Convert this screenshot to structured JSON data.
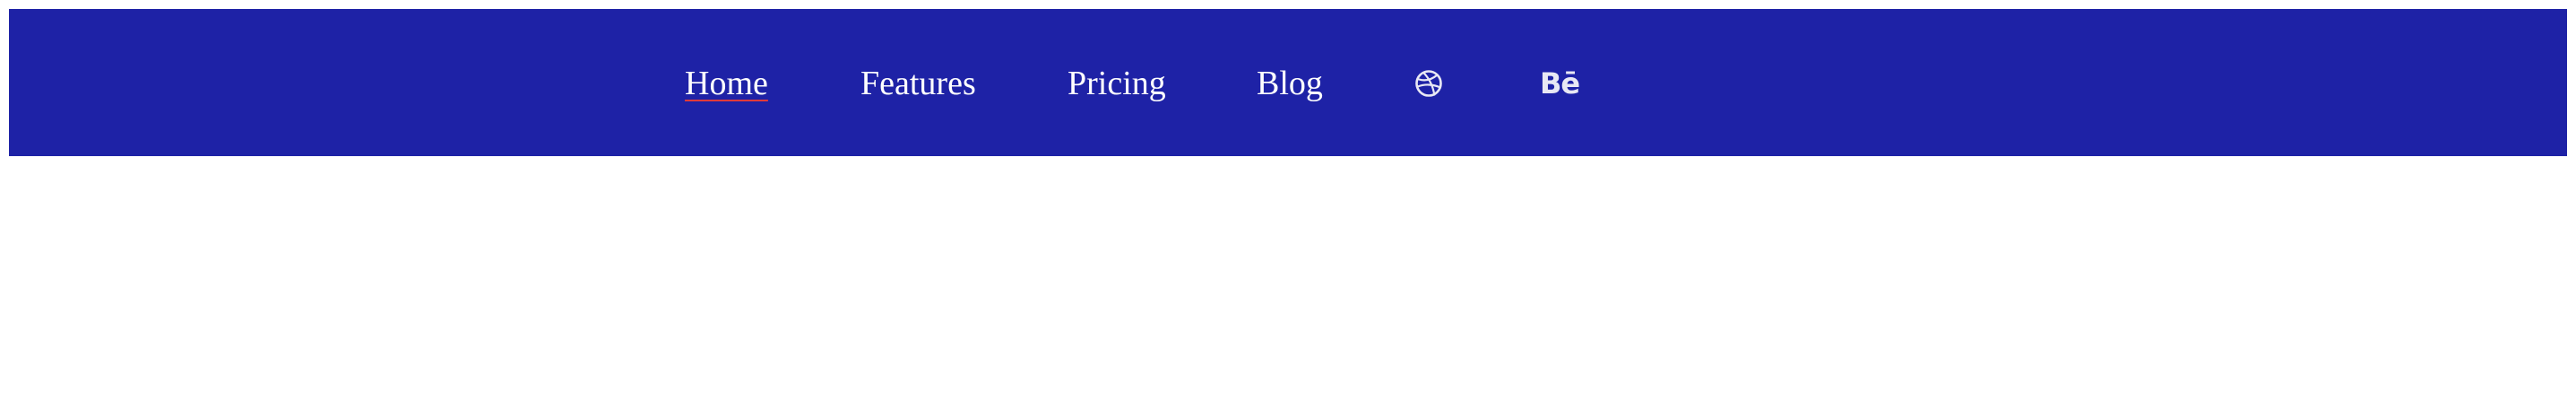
{
  "theme": {
    "navbar_bg": "#1e22a6",
    "link_color": "#ffffff",
    "active_underline": "#e03a3a",
    "icon_color": "#e8e8f4"
  },
  "nav": {
    "links": [
      {
        "label": "Home",
        "active": true
      },
      {
        "label": "Features",
        "active": false
      },
      {
        "label": "Pricing",
        "active": false
      },
      {
        "label": "Blog",
        "active": false
      }
    ],
    "social": [
      {
        "icon": "dribbble-icon"
      },
      {
        "icon": "behance-icon",
        "glyph": "Bē"
      }
    ]
  }
}
